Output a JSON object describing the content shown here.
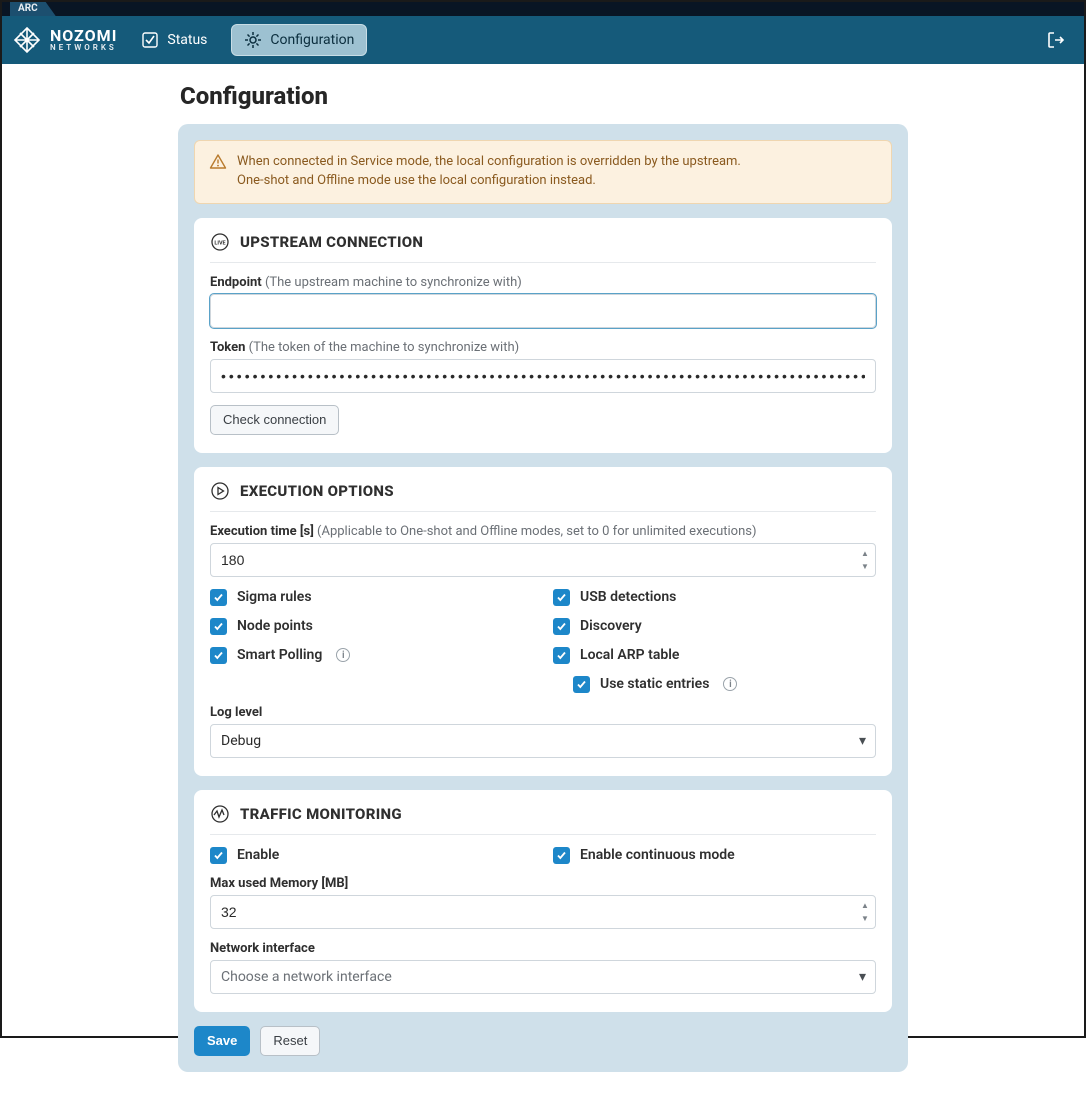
{
  "app": {
    "tag": "ARC",
    "brand_line1": "NOZOMI",
    "brand_line2": "NETWORKS"
  },
  "nav": {
    "status": "Status",
    "configuration": "Configuration"
  },
  "page": {
    "title": "Configuration"
  },
  "alert": {
    "line1": "When connected in Service mode, the local configuration is overridden by the upstream.",
    "line2": "One-shot and Offline mode use the local configuration instead."
  },
  "upstream": {
    "title": "UPSTREAM CONNECTION",
    "endpoint_label": "Endpoint",
    "endpoint_hint": "(The upstream machine to synchronize with)",
    "endpoint_value": "",
    "token_label": "Token",
    "token_hint": "(The token of the machine to synchronize with)",
    "token_value": "••••••••••••••••••••••••••••••••••••••••••••••••••••••••••••••••••••••••••••••••••••••••••••••••••••••••••••••••",
    "check_button": "Check connection"
  },
  "exec": {
    "title": "EXECUTION OPTIONS",
    "time_label": "Execution time [s]",
    "time_hint": "(Applicable to One-shot and Offline modes, set to 0 for unlimited executions)",
    "time_value": "180",
    "cb_sigma": "Sigma rules",
    "cb_usb": "USB detections",
    "cb_node": "Node points",
    "cb_discovery": "Discovery",
    "cb_smart": "Smart Polling",
    "cb_arp": "Local ARP table",
    "cb_static": "Use static entries",
    "loglevel_label": "Log level",
    "loglevel_value": "Debug"
  },
  "traffic": {
    "title": "TRAFFIC MONITORING",
    "cb_enable": "Enable",
    "cb_cont": "Enable continuous mode",
    "mem_label": "Max used Memory [MB]",
    "mem_value": "32",
    "iface_label": "Network interface",
    "iface_value": "Choose a network interface"
  },
  "actions": {
    "save": "Save",
    "reset": "Reset"
  }
}
